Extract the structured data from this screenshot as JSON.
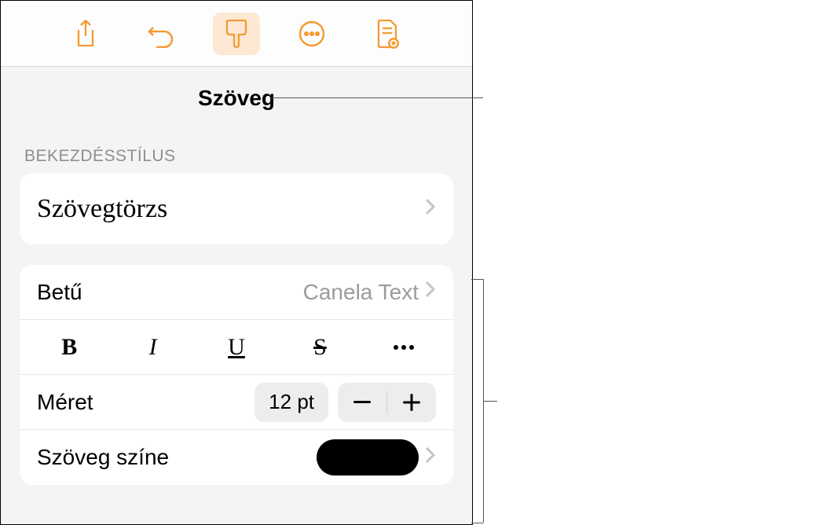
{
  "title": "Szöveg",
  "sections": {
    "paragraph_style_header": "Bekezdésstílus",
    "paragraph_style_value": "Szövegtörzs"
  },
  "font": {
    "label": "Betű",
    "value": "Canela Text"
  },
  "format_buttons": {
    "bold": "B",
    "italic": "I",
    "underline": "U",
    "strike": "S"
  },
  "size": {
    "label": "Méret",
    "value": "12 pt"
  },
  "text_color": {
    "label": "Szöveg színe"
  }
}
